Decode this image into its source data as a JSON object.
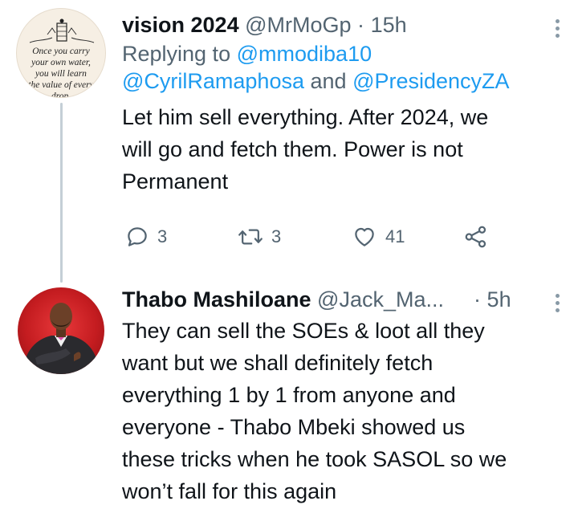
{
  "tweets": [
    {
      "name": "vision 2024",
      "handle": "@MrMoGp",
      "separator": "·",
      "time": "15h",
      "replying_prefix": "Replying to",
      "replying_mentions": [
        "@mmodiba10",
        "@CyrilRamaphosa",
        "@PresidencyZA"
      ],
      "replying_joiner": "and",
      "text_lines": [
        "Let him sell everything. After 2024, we",
        "will go and fetch them. Power is not",
        "Permanent"
      ],
      "avatar_quote": [
        "Once you carry",
        "your own water,",
        "you will learn",
        "the value of every",
        "drop."
      ],
      "avatar_icon": "quote-avatar-icon",
      "actions": {
        "replies": "3",
        "retweets": "3",
        "likes": "41",
        "reply_icon": "reply-icon",
        "retweet_icon": "retweet-icon",
        "like_icon": "heart-icon",
        "share_icon": "share-icon"
      }
    },
    {
      "name": "Thabo Mashiloane",
      "handle": "@Jack_Ma...",
      "separator": "·",
      "time": "5h",
      "avatar_icon": "profile-photo-icon",
      "text_lines": [
        "They can sell the SOEs & loot all they",
        "want but we shall definitely fetch",
        "everything 1 by 1 from anyone and",
        "everyone - Thabo Mbeki showed us",
        "these tricks when he took SASOL so we",
        "won’t fall for this again"
      ]
    }
  ],
  "colors": {
    "accent": "#1d9bf0",
    "secondary_text": "#536471",
    "primary_text": "#0f1419",
    "thread_line": "#c4cfd6"
  }
}
